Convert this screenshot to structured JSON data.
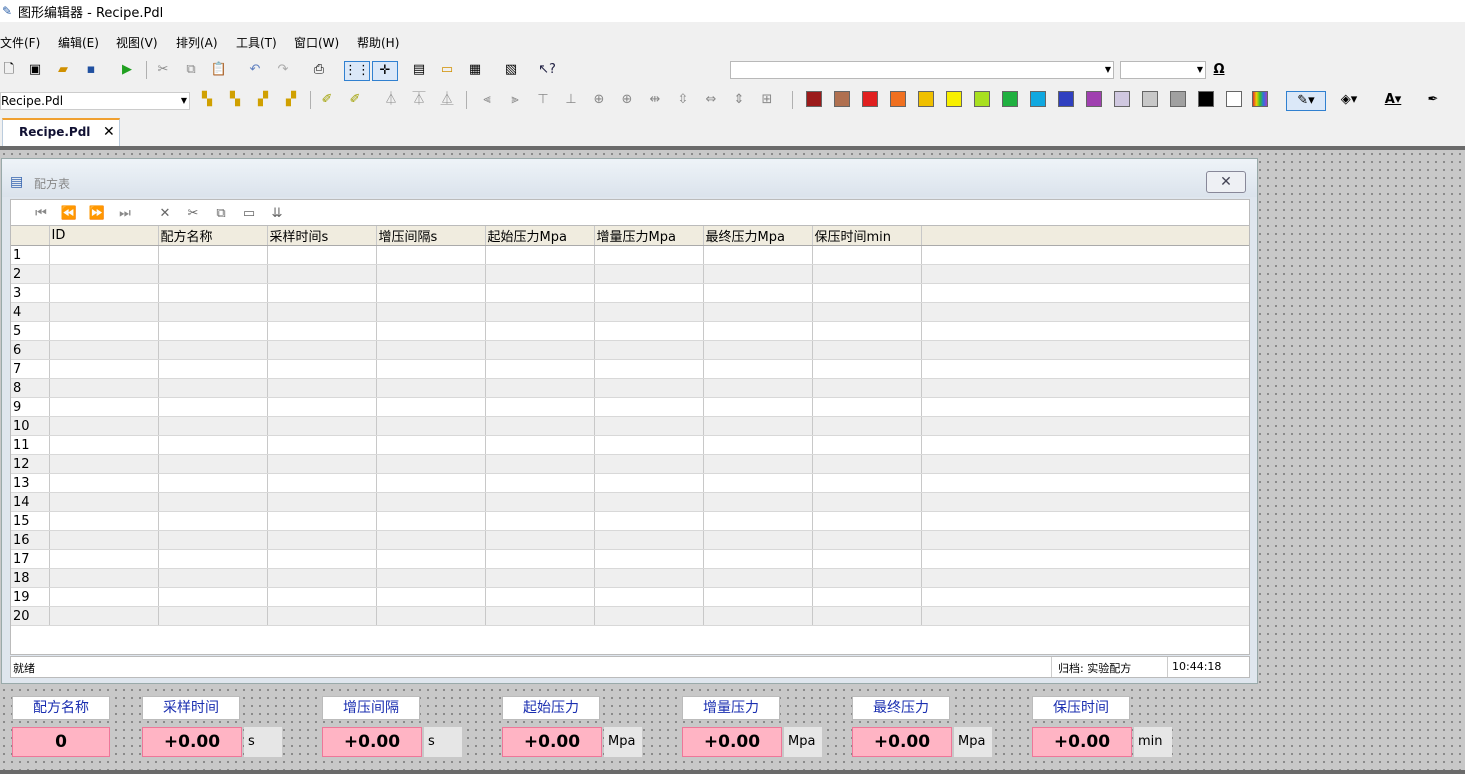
{
  "app": {
    "title": "图形编辑器 - Recipe.Pdl"
  },
  "menu": [
    "文件(F)",
    "编辑(E)",
    "视图(V)",
    "排列(A)",
    "工具(T)",
    "窗口(W)",
    "帮助(H)"
  ],
  "toolbar": {
    "doc_combo": "Recipe.Pdl",
    "omega": "Ω",
    "colors": [
      "#9b1a1a",
      "#b07050",
      "#e02020",
      "#f07020",
      "#f0c000",
      "#f8f000",
      "#a8e020",
      "#20b040",
      "#10a8e0",
      "#3040c0",
      "#a040b0",
      "#d0c8e0",
      "#c8c8c8",
      "#a0a0a0",
      "#000000",
      "#ffffff"
    ]
  },
  "tab": {
    "label": "Recipe.Pdl",
    "close": "✕"
  },
  "recipe_window": {
    "title": "配方表",
    "columns": [
      "ID",
      "配方名称",
      "采样时间s",
      "增压间隔s",
      "起始压力Mpa",
      "增量压力Mpa",
      "最终压力Mpa",
      "保压时间min"
    ],
    "rows": [
      "1",
      "2",
      "3",
      "4",
      "5",
      "6",
      "7",
      "8",
      "9",
      "10",
      "11",
      "12",
      "13",
      "14",
      "15",
      "16",
      "17",
      "18",
      "19",
      "20"
    ],
    "status": "就绪",
    "archive": "归档: 实验配方",
    "time": "10:44:18"
  },
  "fields": [
    {
      "label": "配方名称",
      "value": "0",
      "unit": ""
    },
    {
      "label": "采样时间",
      "value": "+0.00",
      "unit": "s"
    },
    {
      "label": "增压间隔",
      "value": "+0.00",
      "unit": "s"
    },
    {
      "label": "起始压力",
      "value": "+0.00",
      "unit": "Mpa"
    },
    {
      "label": "增量压力",
      "value": "+0.00",
      "unit": "Mpa"
    },
    {
      "label": "最终压力",
      "value": "+0.00",
      "unit": "Mpa"
    },
    {
      "label": "保压时间",
      "value": "+0.00",
      "unit": "min"
    }
  ]
}
